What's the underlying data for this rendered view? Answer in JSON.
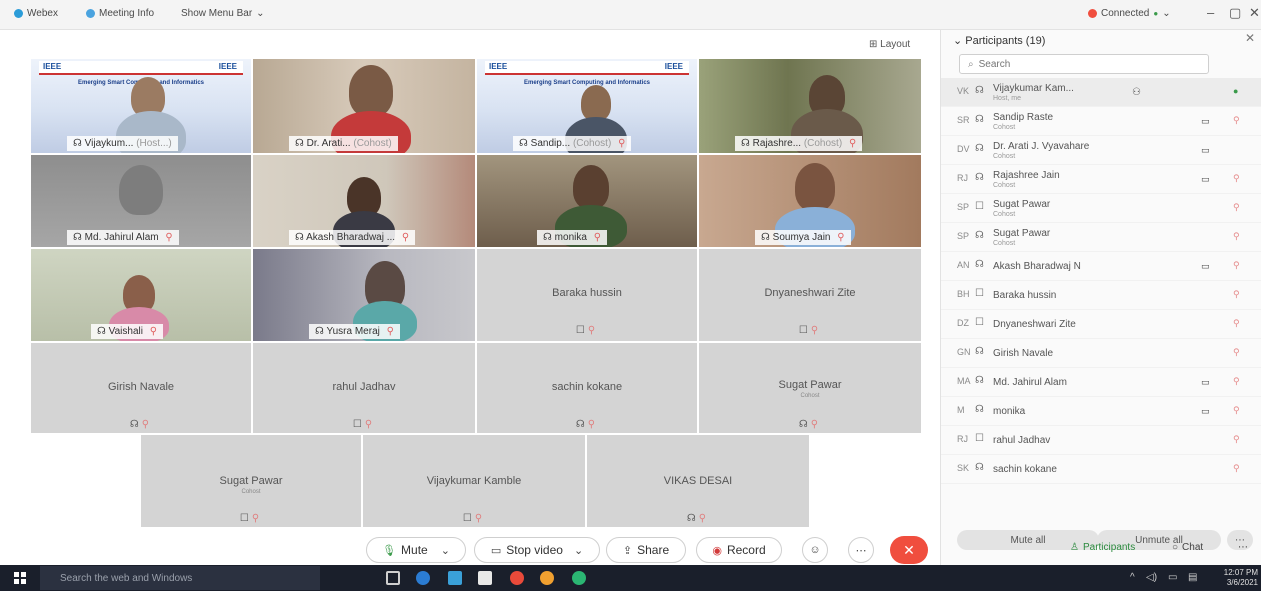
{
  "topbar": {
    "app": "Webex",
    "meeting_info": "Meeting Info",
    "show_menu_bar": "Show Menu Bar",
    "connected": "Connected"
  },
  "stage": {
    "layout_label": "Layout",
    "tiles": {
      "t1": {
        "name": "Vijaykum...",
        "role": "(Host...)"
      },
      "t2": {
        "name": "Dr. Arati...",
        "role": "(Cohost)"
      },
      "t3": {
        "name": "Sandip...",
        "role": "(Cohost)"
      },
      "t4": {
        "name": "Rajashre...",
        "role": "(Cohost)"
      },
      "t5": {
        "name": "Md. Jahirul Alam"
      },
      "t6": {
        "name": "Akash Bharadwaj ..."
      },
      "t7": {
        "name": "monika"
      },
      "t8": {
        "name": "Soumya Jain"
      },
      "t9": {
        "name": "Vaishali"
      },
      "t10": {
        "name": "Yusra Meraj"
      },
      "t11": {
        "name": "Baraka hussin"
      },
      "t12": {
        "name": "Dnyaneshwari Zite"
      },
      "t13": {
        "name": "Girish Navale"
      },
      "t14": {
        "name": "rahul Jadhav"
      },
      "t15": {
        "name": "sachin kokane"
      },
      "t16": {
        "name": "Sugat Pawar",
        "role": "Cohost"
      },
      "t17": {
        "name": "Sugat Pawar",
        "role": "Cohost"
      },
      "t18": {
        "name": "Vijaykumar Kamble"
      },
      "t19": {
        "name": "VIKAS DESAI"
      }
    },
    "poster": {
      "ieee": "IEEE",
      "title_line1": "Emerging Smart Computing and Informatics"
    }
  },
  "controls": {
    "mute": "Mute",
    "stop_video": "Stop video",
    "share": "Share",
    "record": "Record"
  },
  "panel": {
    "title": "Participants (19)",
    "search_placeholder": "Search",
    "participants": [
      {
        "initials": "VK",
        "name": "Vijaykumar Kam...",
        "role": "Host, me",
        "icon": "headset",
        "video": "",
        "audio": "on"
      },
      {
        "initials": "SR",
        "name": "Sandip Raste",
        "role": "Cohost",
        "icon": "headset",
        "video": "cam",
        "audio": "off"
      },
      {
        "initials": "DV",
        "name": "Dr. Arati J. Vyavahare",
        "role": "Cohost",
        "icon": "headset",
        "video": "cam",
        "audio": ""
      },
      {
        "initials": "RJ",
        "name": "Rajashree Jain",
        "role": "Cohost",
        "icon": "headset",
        "video": "cam",
        "audio": "off"
      },
      {
        "initials": "SP",
        "name": "Sugat Pawar",
        "role": "Cohost",
        "icon": "phone",
        "video": "",
        "audio": "off"
      },
      {
        "initials": "SP",
        "name": "Sugat Pawar",
        "role": "Cohost",
        "icon": "headset",
        "video": "",
        "audio": "off"
      },
      {
        "initials": "AN",
        "name": "Akash Bharadwaj N",
        "role": "",
        "icon": "headset",
        "video": "cam",
        "audio": "off"
      },
      {
        "initials": "BH",
        "name": "Baraka hussin",
        "role": "",
        "icon": "phone",
        "video": "",
        "audio": "off"
      },
      {
        "initials": "DZ",
        "name": "Dnyaneshwari Zite",
        "role": "",
        "icon": "phone",
        "video": "",
        "audio": "off"
      },
      {
        "initials": "GN",
        "name": "Girish Navale",
        "role": "",
        "icon": "headset",
        "video": "",
        "audio": "off"
      },
      {
        "initials": "MA",
        "name": "Md. Jahirul Alam",
        "role": "",
        "icon": "headset",
        "video": "cam",
        "audio": "off"
      },
      {
        "initials": "M",
        "name": "monika",
        "role": "",
        "icon": "headset",
        "video": "cam",
        "audio": "off"
      },
      {
        "initials": "RJ",
        "name": "rahul Jadhav",
        "role": "",
        "icon": "phone",
        "video": "",
        "audio": "off"
      },
      {
        "initials": "SK",
        "name": "sachin kokane",
        "role": "",
        "icon": "headset",
        "video": "",
        "audio": "off"
      }
    ],
    "mute_all": "Mute all",
    "unmute_all": "Unmute all",
    "participants_btn": "Participants",
    "chat_btn": "Chat"
  },
  "taskbar": {
    "search": "Search the web and Windows",
    "time": "12:07 PM",
    "date": "3/6/2021"
  },
  "colors": {
    "accent_green": "#3a9a4a",
    "end_red": "#f04e3e",
    "mic_off": "#e08080"
  }
}
